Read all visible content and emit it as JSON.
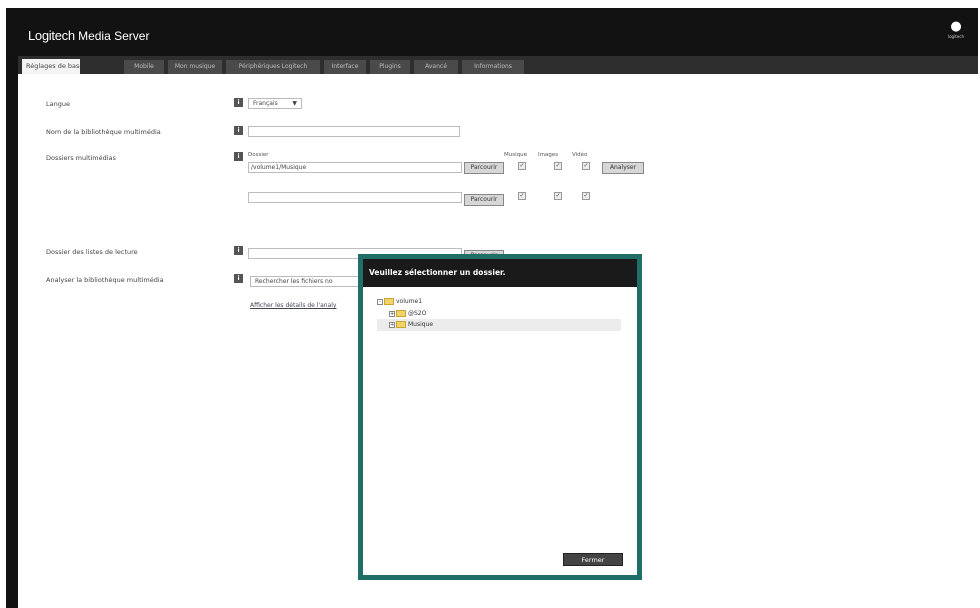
{
  "app": {
    "title_first": "Logitech",
    "title_rest": " Media Server",
    "logo_text": "logitech"
  },
  "tabs": [
    {
      "label": "Réglages de base"
    },
    {
      "label": "Mobile"
    },
    {
      "label": "Mon musique"
    },
    {
      "label": "Périphériques Logitech"
    },
    {
      "label": "Interface"
    },
    {
      "label": "Plugins"
    },
    {
      "label": "Avancé"
    },
    {
      "label": "Informations"
    }
  ],
  "settings": {
    "language": {
      "label": "Langue",
      "value": "Français"
    },
    "library_name": {
      "label": "Nom de la bibliothèque multimédia",
      "value": ""
    },
    "media_folders": {
      "label": "Dossiers multimédias",
      "folder_header": "Dossier",
      "col_music": "Musique",
      "col_images": "Images",
      "col_video": "Vidéo",
      "rows": [
        {
          "path": "/volume1/Musique",
          "browse": "Parcourir",
          "check_mark": "✓"
        },
        {
          "path": "",
          "browse": "Parcourir",
          "check_mark": "✓"
        }
      ],
      "analyze_label": "Analyser"
    },
    "playlists_folder": {
      "label": "Dossier des listes de lecture",
      "value": "",
      "browse": "Parcourir"
    },
    "scan_library": {
      "label": "Analyser la bibliothèque multimédia",
      "select_value": "Rechercher les fichiers no",
      "details_link": "Afficher les détails de l'analy"
    }
  },
  "dialog": {
    "title": "Veuillez sélectionner un dossier.",
    "tree": [
      {
        "label": "volume1",
        "expander": "-"
      },
      {
        "label": "@S2O",
        "expander": "+"
      },
      {
        "label": "Musique",
        "expander": "+"
      }
    ],
    "close_label": "Fermer"
  }
}
